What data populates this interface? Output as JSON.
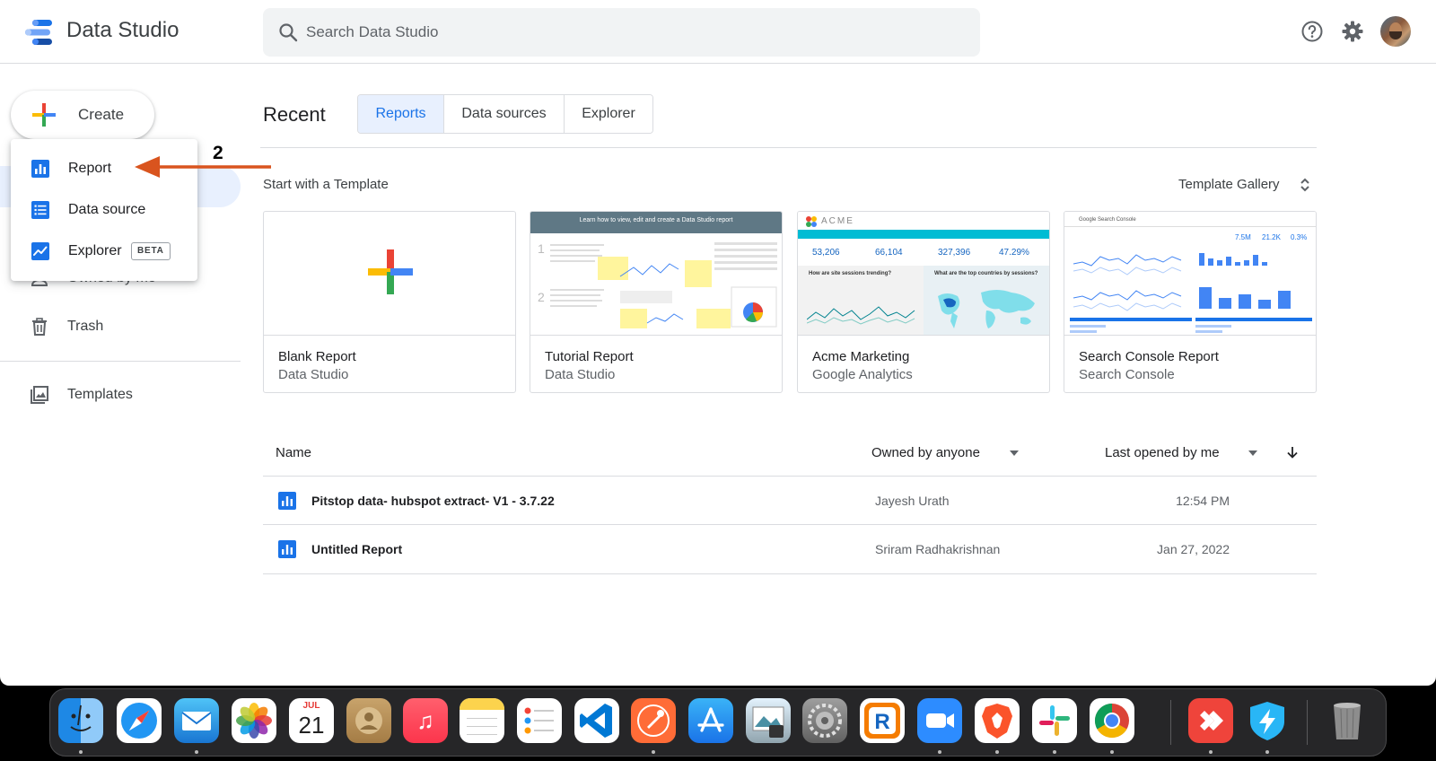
{
  "header": {
    "app_title": "Data Studio",
    "search_placeholder": "Search Data Studio"
  },
  "sidebar": {
    "create_label": "Create",
    "items": [
      {
        "label": "Owned by me",
        "icon": "person-icon"
      },
      {
        "label": "Trash",
        "icon": "trash-icon"
      },
      {
        "label": "Templates",
        "icon": "templates-icon"
      }
    ]
  },
  "create_menu": {
    "items": [
      {
        "label": "Report",
        "icon": "report-icon"
      },
      {
        "label": "Data source",
        "icon": "data-source-icon"
      },
      {
        "label": "Explorer",
        "icon": "explorer-icon",
        "badge": "BETA"
      }
    ]
  },
  "annotation": {
    "step_number": "2"
  },
  "main": {
    "title": "Recent",
    "tabs": [
      {
        "label": "Reports",
        "active": true
      },
      {
        "label": "Data sources",
        "active": false
      },
      {
        "label": "Explorer",
        "active": false
      }
    ],
    "template_heading": "Start with a Template",
    "template_gallery": "Template Gallery",
    "templates": [
      {
        "name": "Blank Report",
        "source": "Data Studio"
      },
      {
        "name": "Tutorial Report",
        "source": "Data Studio",
        "thumb_title": "Learn how to view, edit and create a Data Studio report"
      },
      {
        "name": "Acme Marketing",
        "source": "Google Analytics",
        "thumb_title": "ACME",
        "thumb_question_1": "How are site sessions trending?",
        "thumb_question_2": "What are the top countries by sessions?",
        "metrics": [
          "53,206",
          "66,104",
          "327,396",
          "47.29%"
        ]
      },
      {
        "name": "Search Console Report",
        "source": "Search Console",
        "thumb_title": "Google Search Console",
        "metrics": [
          "7.5M",
          "21.2K",
          "0.3%"
        ]
      }
    ],
    "list": {
      "col_name": "Name",
      "col_owner": "Owned by anyone",
      "col_last_opened": "Last opened by me",
      "rows": [
        {
          "name": "Pitstop data- hubspot extract- V1 - 3.7.22",
          "owner": "Jayesh Urath",
          "date": "12:54 PM"
        },
        {
          "name": "Untitled Report",
          "owner": "Sriram Radhakrishnan",
          "date": "Jan 27, 2022"
        }
      ]
    }
  },
  "dock": {
    "calendar_month": "JUL",
    "calendar_day": "21",
    "apps": [
      "finder-icon",
      "safari-icon",
      "mail-icon",
      "photos-icon",
      "calendar-icon",
      "contacts-icon",
      "music-icon",
      "notes-icon",
      "reminders-icon",
      "vscode-icon",
      "postman-icon",
      "app-store-icon",
      "preview-icon",
      "system-preferences-icon",
      "r-app-icon",
      "zoom-icon",
      "brave-icon",
      "slack-icon",
      "chrome-icon",
      "anydesk-icon",
      "shortcut-icon",
      "trash-icon"
    ]
  },
  "colors": {
    "accent_blue": "#1a73e8",
    "annotation_arrow": "#d9541e",
    "selected_tab_bg": "#e8f0fe"
  }
}
